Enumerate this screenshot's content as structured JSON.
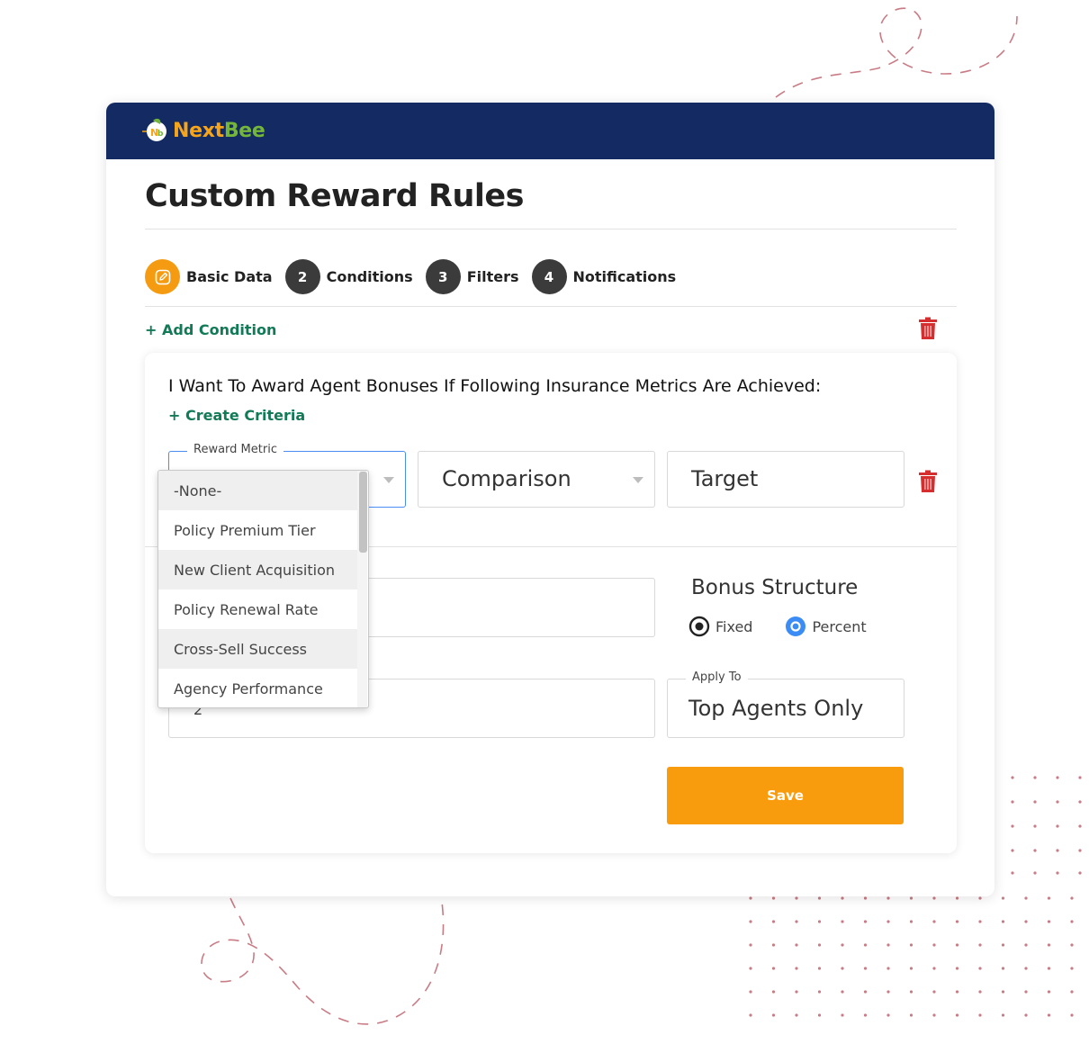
{
  "brand": {
    "name_part1": "Next",
    "name_part2": "Bee",
    "colors": {
      "header_bg": "#132a62",
      "accent_orange": "#f59b12",
      "accent_green": "#127a57",
      "danger": "#d62e2e"
    }
  },
  "page": {
    "title": "Custom Reward Rules"
  },
  "steps": [
    {
      "label": "Basic Data",
      "icon": "edit-icon",
      "active": true
    },
    {
      "number": "2",
      "label": "Conditions"
    },
    {
      "number": "3",
      "label": "Filters"
    },
    {
      "number": "4",
      "label": "Notifications"
    }
  ],
  "actions": {
    "add_condition": "+ Add Condition",
    "create_criteria": "+ Create Criteria",
    "save": "Save"
  },
  "condition": {
    "question": "I Want To Award Agent Bonuses If Following Insurance Metrics Are Achieved:",
    "reward_metric_label": "Reward Metric",
    "comparison_placeholder": "Comparison",
    "target_placeholder": "Target",
    "second_input_value": "2",
    "apply_to_label": "Apply To",
    "apply_to_value": "Top Agents Only"
  },
  "bonus": {
    "title": "Bonus Structure",
    "options": [
      {
        "label": "Fixed",
        "selected": false
      },
      {
        "label": "Percent",
        "selected": true
      }
    ]
  },
  "dropdown": {
    "options": [
      "-None-",
      "Policy Premium Tier",
      "New Client Acquisition",
      "Policy Renewal Rate",
      "Cross-Sell Success",
      "Agency Performance"
    ]
  }
}
